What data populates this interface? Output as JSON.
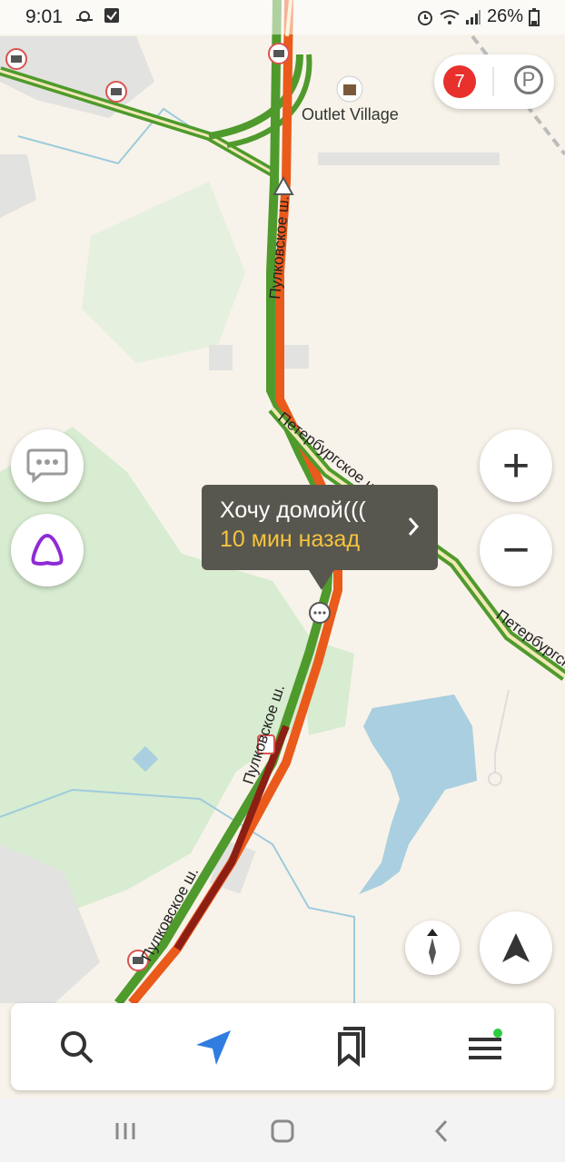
{
  "status_bar": {
    "time": "9:01",
    "battery": "26%",
    "left_icons": [
      "weather-icon",
      "checkbox-icon"
    ],
    "right_icons": [
      "alarm-icon",
      "wifi-icon",
      "signal-icon",
      "battery-icon"
    ]
  },
  "map": {
    "poi_label": "Outlet Village",
    "road_labels": {
      "pulkovskoe_upper": "Пулковское ш.",
      "pulkovskoe_middle": "Пулковское ш.",
      "pulkovskoe_lower": "Пулковское ш.",
      "peterburgskoe_upper": "Петербургское ш.",
      "peterburgskoe_lower": "Петербургское ш."
    }
  },
  "traffic_level": "7",
  "parking_label": "P",
  "comment_bubble": {
    "text": "Хочу домой(((",
    "time": "10 мин назад"
  },
  "controls": {
    "zoom_in": "+",
    "zoom_out": "−"
  },
  "bottom_tabs": [
    {
      "name": "search",
      "icon": "search-icon"
    },
    {
      "name": "navigation",
      "icon": "navigation-arrow-icon"
    },
    {
      "name": "bookmarks",
      "icon": "bookmarks-icon"
    },
    {
      "name": "menu",
      "icon": "menu-icon"
    }
  ],
  "colors": {
    "traffic_red": "#e8302d",
    "route_green": "#4f9a2c",
    "route_orange": "#ea5a1b",
    "route_darkred": "#8c1f14",
    "alice_purple": "#8e2ad6",
    "nav_blue": "#2f7de1",
    "bubble_time": "#f7c33d"
  }
}
